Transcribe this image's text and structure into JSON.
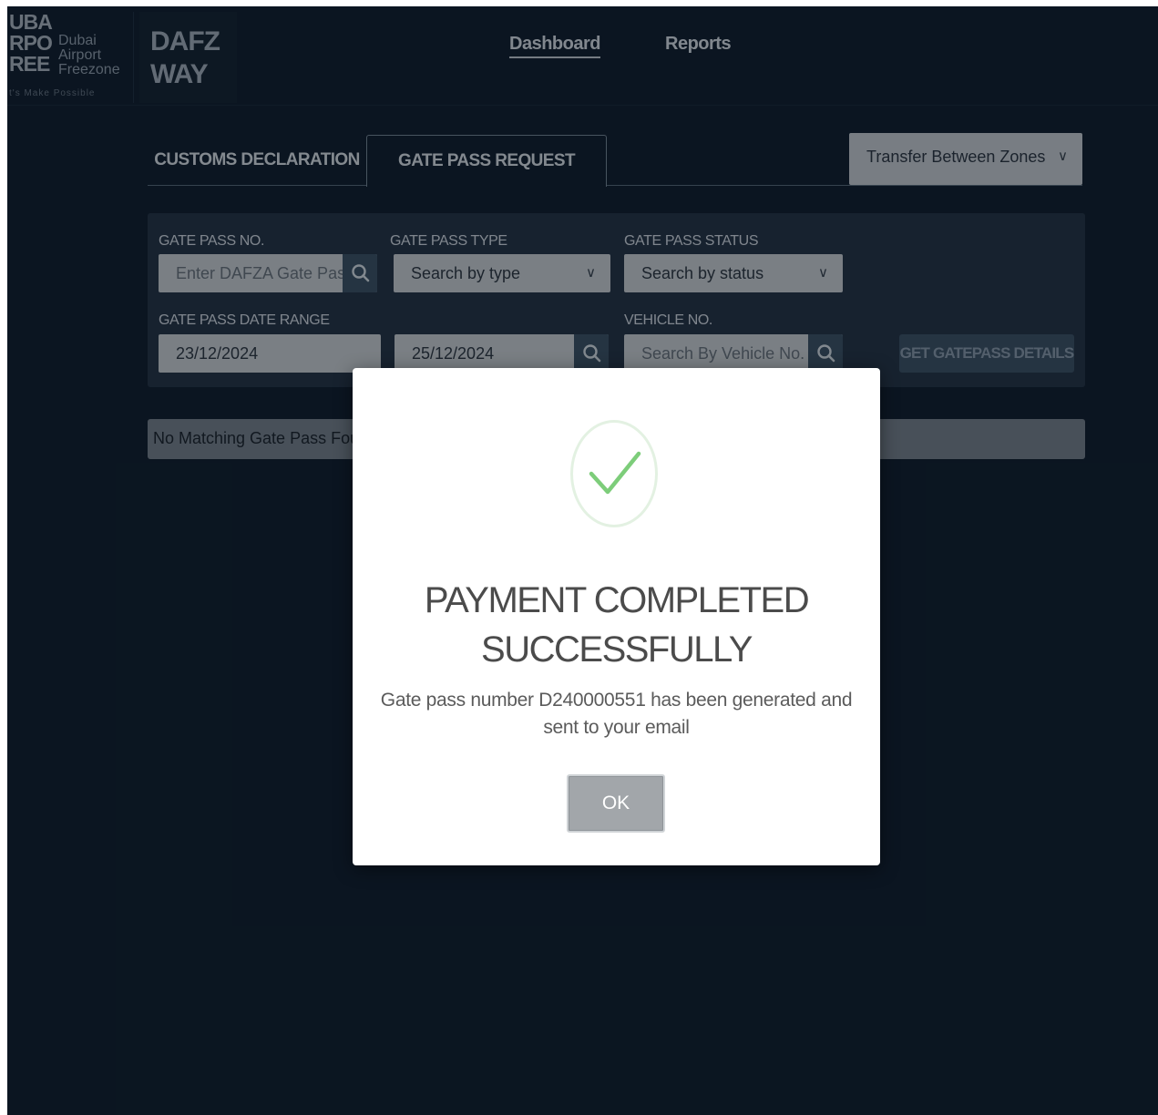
{
  "header": {
    "logo": {
      "big_text": "UBA\nRPO\nREE",
      "small_text": "Dubai\nAirport\nFreezone",
      "tagline": "t's Make Possible",
      "brand_line1": "DAFZ",
      "brand_line2": "WAY"
    },
    "nav": [
      {
        "label": "Dashboard",
        "active": true
      },
      {
        "label": "Reports",
        "active": false
      }
    ]
  },
  "tabs": [
    {
      "label": "CUSTOMS DECLARATION",
      "active": false
    },
    {
      "label": "GATE PASS REQUEST",
      "active": true
    }
  ],
  "zone_select": {
    "value": "Transfer Between Zones",
    "icon": "chevron-down-icon"
  },
  "filters": {
    "gate_pass_no": {
      "label": "GATE PASS NO.",
      "placeholder": "Enter DAFZA Gate Pas"
    },
    "gate_pass_type": {
      "label": "GATE PASS TYPE",
      "value": "Search by type"
    },
    "gate_pass_status": {
      "label": "GATE PASS STATUS",
      "value": "Search by status"
    },
    "date_range": {
      "label": "GATE PASS DATE RANGE",
      "from": "23/12/2024",
      "to": "25/12/2024"
    },
    "vehicle_no": {
      "label": "VEHICLE NO.",
      "placeholder": "Search By Vehicle No."
    },
    "get_button": "GET GATEPASS DETAILS"
  },
  "results": {
    "message": "No Matching Gate Pass Found"
  },
  "modal": {
    "title_line1": "PAYMENT COMPLETED",
    "title_line2": "SUCCESSFULLY",
    "message": "Gate pass number D240000551 has been generated and sent to your email",
    "ok_label": "OK",
    "icon": "check-icon",
    "accent_color": "#7dcd7a"
  },
  "colors": {
    "background": "#0f1c2a",
    "panel": "#253444",
    "button": "#3e5466"
  }
}
